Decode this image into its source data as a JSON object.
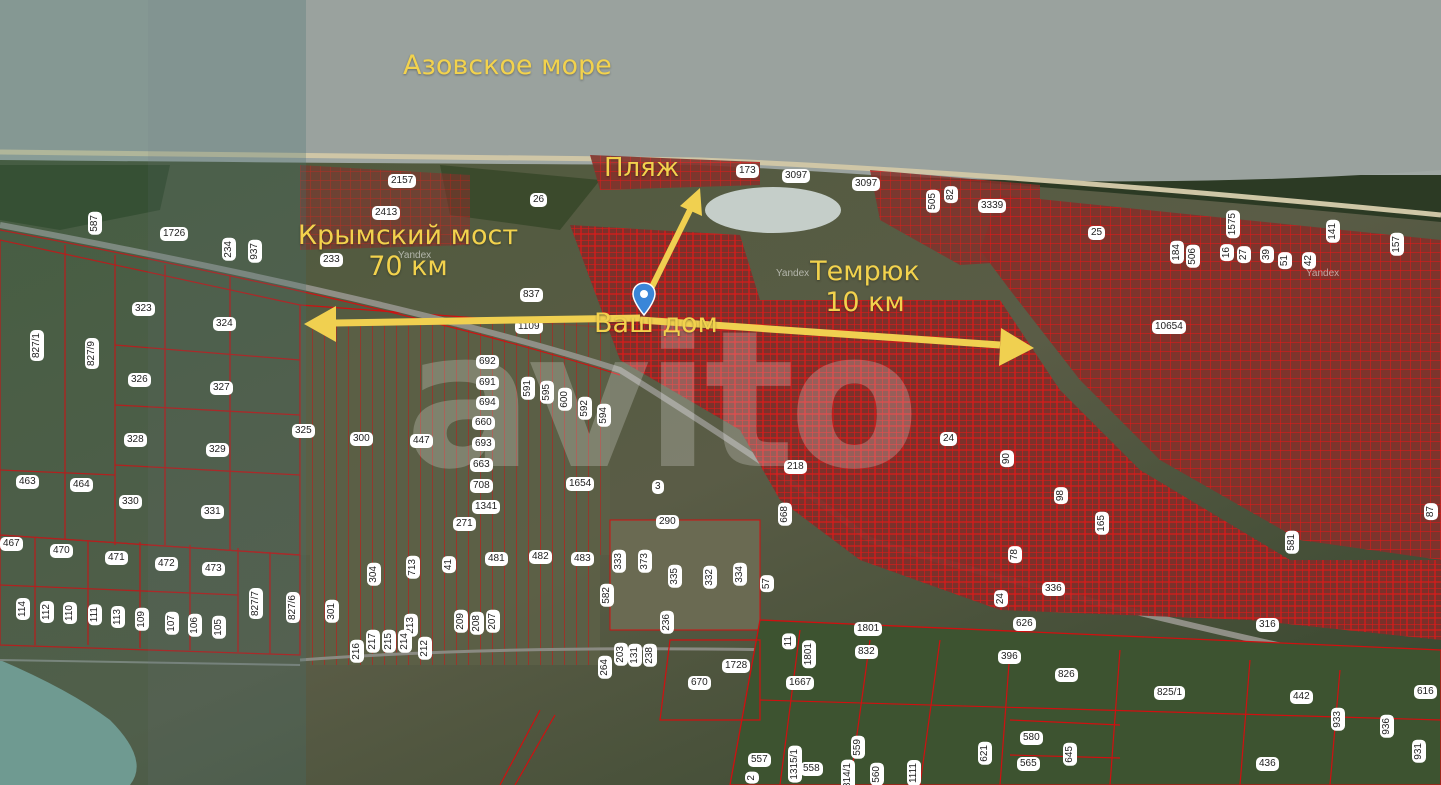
{
  "map": {
    "labels": {
      "sea": "Азовское море",
      "beach": "Пляж",
      "bridge_line1": "Крымский мост",
      "bridge_line2": "70 км",
      "temryuk_line1": "Темрюк",
      "temryuk_line2": "10 км",
      "home": "Ваш дом"
    },
    "watermark": "avito",
    "provider": "Yandex",
    "colors": {
      "label": "#f2d24d",
      "arrow": "#f0d050",
      "parcel_border": "#d01010",
      "marker": "#3a86d8"
    },
    "marker_icon": "map-pin-icon",
    "parcels": [
      {
        "id": "p2157",
        "text": "2157"
      },
      {
        "id": "p2413",
        "text": "2413"
      },
      {
        "id": "p1726",
        "text": "1726"
      },
      {
        "id": "p587",
        "text": "587"
      },
      {
        "id": "p234",
        "text": "234"
      },
      {
        "id": "p937",
        "text": "937"
      },
      {
        "id": "p233",
        "text": "233"
      },
      {
        "id": "p26",
        "text": "26"
      },
      {
        "id": "p173",
        "text": "173"
      },
      {
        "id": "p3097a",
        "text": "3097"
      },
      {
        "id": "p3097b",
        "text": "3097"
      },
      {
        "id": "p505",
        "text": "505"
      },
      {
        "id": "p82",
        "text": "82"
      },
      {
        "id": "p3339",
        "text": "3339"
      },
      {
        "id": "p25",
        "text": "25"
      },
      {
        "id": "p184",
        "text": "184"
      },
      {
        "id": "p506",
        "text": "506"
      },
      {
        "id": "p1575",
        "text": "1575"
      },
      {
        "id": "p16",
        "text": "16"
      },
      {
        "id": "p27",
        "text": "27"
      },
      {
        "id": "p39",
        "text": "39"
      },
      {
        "id": "p51",
        "text": "51"
      },
      {
        "id": "p42",
        "text": "42"
      },
      {
        "id": "p141",
        "text": "141"
      },
      {
        "id": "p157",
        "text": "157"
      },
      {
        "id": "p837",
        "text": "837"
      },
      {
        "id": "p323",
        "text": "323"
      },
      {
        "id": "p324",
        "text": "324"
      },
      {
        "id": "p827_1",
        "text": "827/1"
      },
      {
        "id": "p827_9",
        "text": "827/9"
      },
      {
        "id": "p1109",
        "text": "1109"
      },
      {
        "id": "p10654",
        "text": "10654"
      },
      {
        "id": "p326",
        "text": "326"
      },
      {
        "id": "p327",
        "text": "327"
      },
      {
        "id": "p692",
        "text": "692"
      },
      {
        "id": "p691",
        "text": "691"
      },
      {
        "id": "p694",
        "text": "694"
      },
      {
        "id": "p591",
        "text": "591"
      },
      {
        "id": "p595",
        "text": "595"
      },
      {
        "id": "p600",
        "text": "600"
      },
      {
        "id": "p592",
        "text": "592"
      },
      {
        "id": "p594",
        "text": "594"
      },
      {
        "id": "p325",
        "text": "325"
      },
      {
        "id": "p328",
        "text": "328"
      },
      {
        "id": "p329",
        "text": "329"
      },
      {
        "id": "p300",
        "text": "300"
      },
      {
        "id": "p447",
        "text": "447"
      },
      {
        "id": "p660",
        "text": "660"
      },
      {
        "id": "p693",
        "text": "693"
      },
      {
        "id": "p24",
        "text": "24"
      },
      {
        "id": "p663",
        "text": "663"
      },
      {
        "id": "p218",
        "text": "218"
      },
      {
        "id": "p90",
        "text": "90"
      },
      {
        "id": "p463",
        "text": "463"
      },
      {
        "id": "p464",
        "text": "464"
      },
      {
        "id": "p708",
        "text": "708"
      },
      {
        "id": "p1654",
        "text": "1654"
      },
      {
        "id": "p3",
        "text": "3"
      },
      {
        "id": "p330",
        "text": "330"
      },
      {
        "id": "p331",
        "text": "331"
      },
      {
        "id": "p1341",
        "text": "1341"
      },
      {
        "id": "p98",
        "text": "98"
      },
      {
        "id": "p271",
        "text": "271"
      },
      {
        "id": "p290",
        "text": "290"
      },
      {
        "id": "p668",
        "text": "668"
      },
      {
        "id": "p165",
        "text": "165"
      },
      {
        "id": "p87",
        "text": "87"
      },
      {
        "id": "p581",
        "text": "581"
      },
      {
        "id": "p467",
        "text": "467"
      },
      {
        "id": "p470",
        "text": "470"
      },
      {
        "id": "p471",
        "text": "471"
      },
      {
        "id": "p472",
        "text": "472"
      },
      {
        "id": "p473",
        "text": "473"
      },
      {
        "id": "p481",
        "text": "481"
      },
      {
        "id": "p482",
        "text": "482"
      },
      {
        "id": "p483",
        "text": "483"
      },
      {
        "id": "p333",
        "text": "333"
      },
      {
        "id": "p373",
        "text": "373"
      },
      {
        "id": "p335",
        "text": "335"
      },
      {
        "id": "p332",
        "text": "332"
      },
      {
        "id": "p334",
        "text": "334"
      },
      {
        "id": "p304",
        "text": "304"
      },
      {
        "id": "p713",
        "text": "713"
      },
      {
        "id": "p41",
        "text": "41"
      },
      {
        "id": "p78",
        "text": "78"
      },
      {
        "id": "p336",
        "text": "336"
      },
      {
        "id": "p582",
        "text": "582"
      },
      {
        "id": "p57",
        "text": "57"
      },
      {
        "id": "p24b",
        "text": "24"
      },
      {
        "id": "p114",
        "text": "114"
      },
      {
        "id": "p112",
        "text": "112"
      },
      {
        "id": "p110",
        "text": "110"
      },
      {
        "id": "p111",
        "text": "111"
      },
      {
        "id": "p113",
        "text": "113"
      },
      {
        "id": "p109",
        "text": "109"
      },
      {
        "id": "p107",
        "text": "107"
      },
      {
        "id": "p106",
        "text": "106"
      },
      {
        "id": "p105",
        "text": "105"
      },
      {
        "id": "p827_7",
        "text": "827/7"
      },
      {
        "id": "p827_6",
        "text": "827/6"
      },
      {
        "id": "p301",
        "text": "301"
      },
      {
        "id": "p209",
        "text": "209"
      },
      {
        "id": "p208",
        "text": "208"
      },
      {
        "id": "p207",
        "text": "207"
      },
      {
        "id": "p236",
        "text": "236"
      },
      {
        "id": "p626",
        "text": "626"
      },
      {
        "id": "p316",
        "text": "316"
      },
      {
        "id": "p213",
        "text": "213"
      },
      {
        "id": "p1801a",
        "text": "1801"
      },
      {
        "id": "p216",
        "text": "216"
      },
      {
        "id": "p217",
        "text": "217"
      },
      {
        "id": "p215",
        "text": "215"
      },
      {
        "id": "p214",
        "text": "214"
      },
      {
        "id": "p212",
        "text": "212"
      },
      {
        "id": "p203",
        "text": "203"
      },
      {
        "id": "p131",
        "text": "131"
      },
      {
        "id": "p238",
        "text": "238"
      },
      {
        "id": "p11",
        "text": "11"
      },
      {
        "id": "p1801b",
        "text": "1801"
      },
      {
        "id": "p832",
        "text": "832"
      },
      {
        "id": "p396",
        "text": "396"
      },
      {
        "id": "p264",
        "text": "264"
      },
      {
        "id": "p1728",
        "text": "1728"
      },
      {
        "id": "p670",
        "text": "670"
      },
      {
        "id": "p1667",
        "text": "1667"
      },
      {
        "id": "p826",
        "text": "826"
      },
      {
        "id": "p825_1",
        "text": "825/1"
      },
      {
        "id": "p442",
        "text": "442"
      },
      {
        "id": "p616",
        "text": "616"
      },
      {
        "id": "p933",
        "text": "933"
      },
      {
        "id": "p936",
        "text": "936"
      },
      {
        "id": "p580",
        "text": "580"
      },
      {
        "id": "p621",
        "text": "621"
      },
      {
        "id": "p645",
        "text": "645"
      },
      {
        "id": "p557",
        "text": "557"
      },
      {
        "id": "p1315_1",
        "text": "1315/1"
      },
      {
        "id": "p559",
        "text": "559"
      },
      {
        "id": "p1314_1",
        "text": "1314/1"
      },
      {
        "id": "p565",
        "text": "565"
      },
      {
        "id": "p436",
        "text": "436"
      },
      {
        "id": "p931",
        "text": "931"
      },
      {
        "id": "p558",
        "text": "558"
      },
      {
        "id": "p560",
        "text": "560"
      },
      {
        "id": "p1111",
        "text": "1111"
      },
      {
        "id": "p2",
        "text": "2"
      }
    ]
  }
}
